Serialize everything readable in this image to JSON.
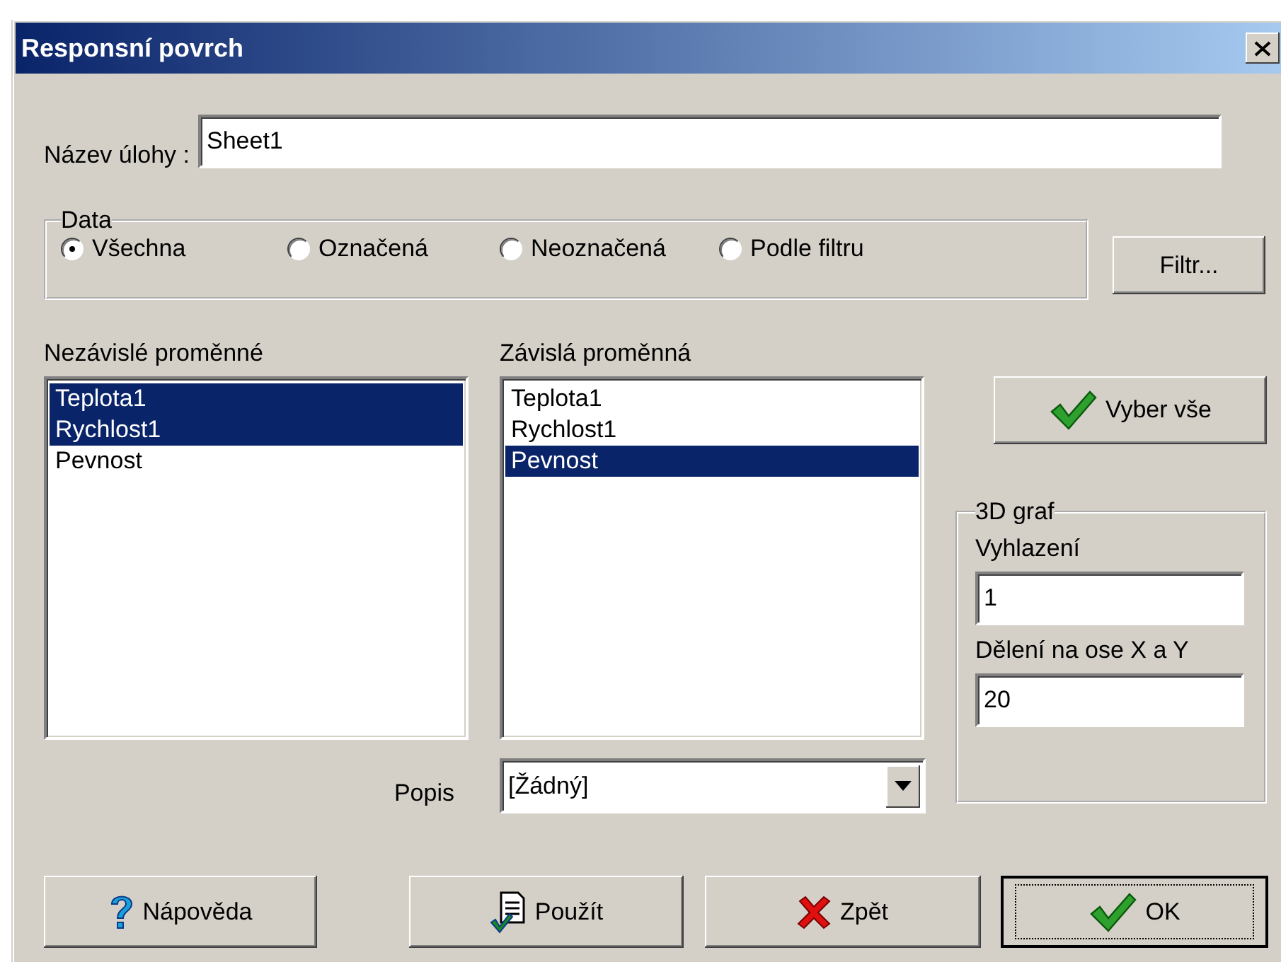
{
  "window": {
    "title": "Responsní povrch"
  },
  "task_name": {
    "label": "Název úlohy :",
    "value": "Sheet1"
  },
  "data_group": {
    "title": "Data",
    "options": [
      {
        "label": "Všechna",
        "selected": true
      },
      {
        "label": "Označená",
        "selected": false
      },
      {
        "label": "Neoznačená",
        "selected": false
      },
      {
        "label": "Podle filtru",
        "selected": false
      }
    ]
  },
  "filter_button": "Filtr...",
  "independent": {
    "label": "Nezávislé proměnné",
    "items": [
      {
        "label": "Teplota1",
        "selected": true
      },
      {
        "label": "Rychlost1",
        "selected": true
      },
      {
        "label": "Pevnost",
        "selected": false
      }
    ]
  },
  "dependent": {
    "label": "Závislá proměnná",
    "items": [
      {
        "label": "Teplota1",
        "selected": false
      },
      {
        "label": "Rychlost1",
        "selected": false
      },
      {
        "label": "Pevnost",
        "selected": true
      }
    ]
  },
  "select_all_button": "Vyber vše",
  "graph_group": {
    "title": "3D graf",
    "fields": [
      {
        "label": "Vyhlazení",
        "value": "1"
      },
      {
        "label": "Dělení na ose X a Y",
        "value": "20"
      }
    ]
  },
  "caption": {
    "label": "Popis",
    "value": "[Žádný]"
  },
  "buttons": [
    {
      "label": "Nápověda",
      "kind": "help",
      "default": false
    },
    {
      "label": "Použít",
      "kind": "apply",
      "default": false
    },
    {
      "label": "Zpět",
      "kind": "cancel",
      "default": false
    },
    {
      "label": "OK",
      "kind": "ok",
      "default": true
    }
  ]
}
